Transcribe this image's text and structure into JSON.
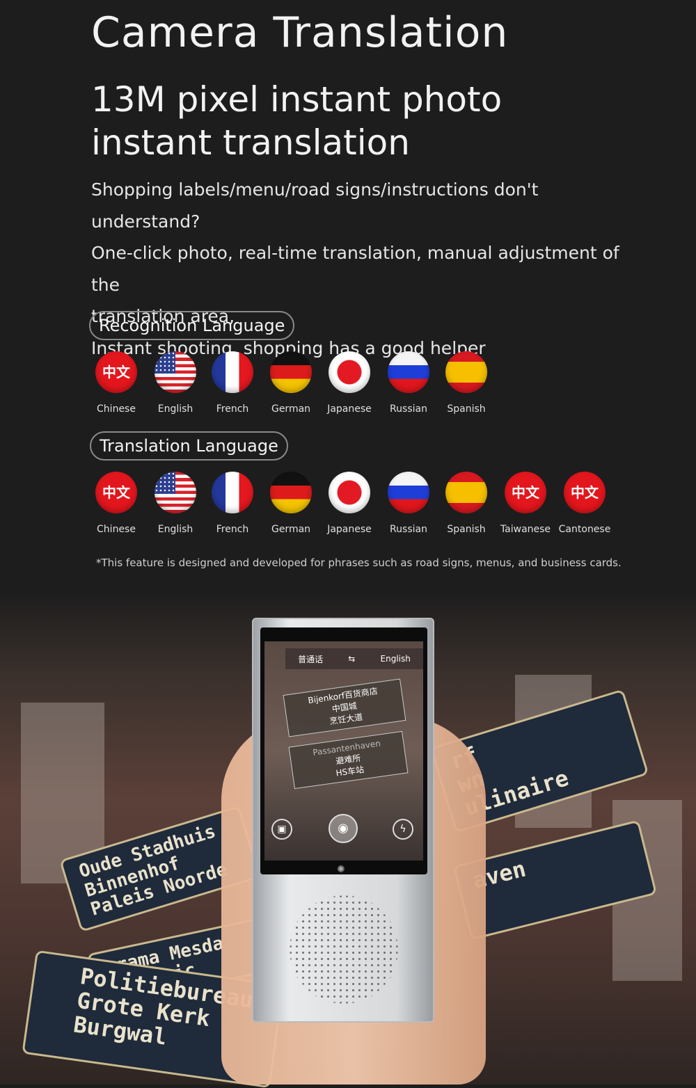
{
  "header": {
    "title": "Camera Translation",
    "subtitle_line1": "13M pixel instant photo",
    "subtitle_line2": "instant translation"
  },
  "description": [
    "Shopping labels/menu/road signs/instructions don't understand?",
    "One-click photo, real-time translation, manual adjustment of the",
    "translation area,",
    "Instant shooting, shopping has a good helper"
  ],
  "recognition": {
    "label": "Recognition Language",
    "languages": [
      {
        "name": "Chinese",
        "flag": "zh",
        "glyph": "中文"
      },
      {
        "name": "English",
        "flag": "en"
      },
      {
        "name": "French",
        "flag": "fr"
      },
      {
        "name": "German",
        "flag": "de"
      },
      {
        "name": "Japanese",
        "flag": "ja"
      },
      {
        "name": "Russian",
        "flag": "ru"
      },
      {
        "name": "Spanish",
        "flag": "es"
      }
    ]
  },
  "translation": {
    "label": "Translation Language",
    "languages": [
      {
        "name": "Chinese",
        "flag": "zh",
        "glyph": "中文"
      },
      {
        "name": "English",
        "flag": "en"
      },
      {
        "name": "French",
        "flag": "fr"
      },
      {
        "name": "German",
        "flag": "de"
      },
      {
        "name": "Japanese",
        "flag": "ja"
      },
      {
        "name": "Russian",
        "flag": "ru"
      },
      {
        "name": "Spanish",
        "flag": "es"
      },
      {
        "name": "Taiwanese",
        "flag": "zh",
        "glyph": "中文"
      },
      {
        "name": "Cantonese",
        "flag": "zh",
        "glyph": "中文"
      }
    ]
  },
  "note": "*This feature is designed and developed for phrases such as road signs, menus, and business cards.",
  "device": {
    "source_lang": "普通话",
    "swap_icon": "swap-arrows",
    "target_lang": "English",
    "sign1": [
      "Bijenkorf百货商店",
      "中国城",
      "烹饪大道"
    ],
    "sign2": [
      "Passantenhaven",
      "避难所",
      "HS车站"
    ]
  },
  "scene_signs": {
    "left_upper": [
      "Oude Stadhuis",
      "Binnenhof",
      "Paleis Noorde"
    ],
    "left_middle": [
      "orama Mesda",
      "Communic"
    ],
    "left_lower": [
      "Politiebureau",
      "Grote Kerk",
      "Burgwal"
    ],
    "right_upper": [
      "rf",
      "wn",
      "ulinaire"
    ],
    "right_lower": [
      "aven"
    ]
  }
}
